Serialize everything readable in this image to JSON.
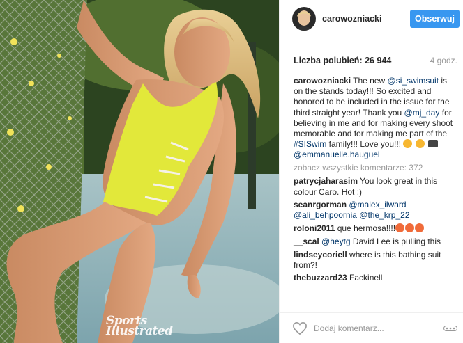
{
  "post": {
    "watermark_line1": "Sports",
    "watermark_line2": "Illustrated"
  },
  "header": {
    "username": "carowozniacki",
    "follow_label": "Obserwuj",
    "avatar_icon": "avatar-photo"
  },
  "meta": {
    "likes": "Liczba polubień: 26 944",
    "time": "4 godz."
  },
  "caption": {
    "author": "carowozniacki",
    "part1": " The new ",
    "mention1": "@si_swimsuit",
    "part2": " is on the stands today!!! So excited and honored to be included in the issue for the third straight year! Thank you ",
    "mention2": "@mj_day",
    "part3": " for believing in me and for making every shoot memorable and for making me part of the ",
    "hashtag": "#SISwim",
    "part4": " family!!! Love you!!! ",
    "mention3": "@emmanuelle.hauguel"
  },
  "view_all": "zobacz wszystkie komentarze: 372",
  "comments": [
    {
      "user": "patrycjaharasim",
      "text": " You look great in this colour Caro. Hot :)"
    },
    {
      "user": "seanrgorman",
      "mention_a": "@malex_ilward",
      "mention_b": "@ali_behpoornia",
      "mention_c": "@the_krp_22"
    },
    {
      "user": "roloni2011",
      "text": " que hermosa!!!!"
    },
    {
      "user": "__scal",
      "mention": "@heytg",
      "text": " David Lee is pulling this"
    },
    {
      "user": "lindseycoriell",
      "text": " where is this bathing suit from?!"
    },
    {
      "user": "thebuzzard23",
      "text": " Fackinell"
    }
  ],
  "footer": {
    "comment_placeholder": "Dodaj komentarz...",
    "like_icon": "heart-outline-icon",
    "more_icon": "more-options-icon"
  }
}
